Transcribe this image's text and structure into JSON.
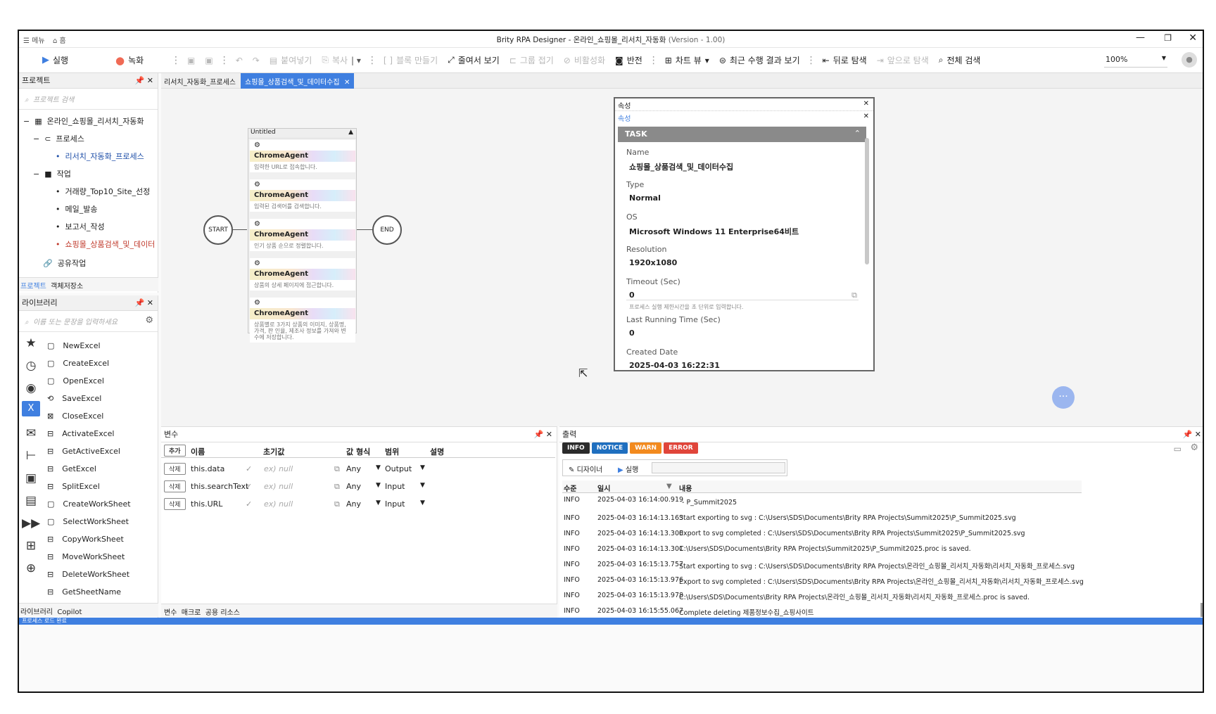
{
  "titlebar": {
    "menu": "메뉴",
    "home": "홈",
    "title": "Brity RPA Designer - 온라인_쇼핑몰_리서치_자동화",
    "version": "(Version - 1.00)"
  },
  "toolbar": {
    "run": "실행",
    "record": "녹화",
    "paste": "붙여넣기",
    "copy": "복사",
    "block": "블록 만들기",
    "zoom_out": "줄여서 보기",
    "group": "그룹 접기",
    "disable": "비활성화",
    "invert": "반전",
    "chart_view": "차트 뷰",
    "recent": "최근 수행 결과 보기",
    "back": "뒤로 탐색",
    "forward": "앞으로 탐색",
    "search_all": "전체 검색",
    "zoom": "100%"
  },
  "project": {
    "title": "프로젝트",
    "search_placeholder": "프로젝트 검색",
    "root": "온라인_쇼핑몰_리서치_자동화",
    "process_group": "프로세스",
    "process_item": "리서치_자동화_프로세스",
    "task_group": "작업",
    "tasks": [
      "거래량_Top10_Site_선정",
      "메일_발송",
      "보고서_작성",
      "쇼핑몰_상품검색_및_데이터수"
    ],
    "shared": "공유작업",
    "tabs": [
      "프로젝트",
      "객체저장소"
    ]
  },
  "library": {
    "title": "라이브러리",
    "search_placeholder": "이름 또는 문장을 입력하세요",
    "items": [
      "NewExcel",
      "CreateExcel",
      "OpenExcel",
      "SaveExcel",
      "CloseExcel",
      "ActivateExcel",
      "GetActiveExcel",
      "GetExcel",
      "SplitExcel",
      "CreateWorkSheet",
      "SelectWorkSheet",
      "CopyWorkSheet",
      "MoveWorkSheet",
      "DeleteWorkSheet",
      "GetSheetName"
    ],
    "tabs": [
      "라이브러리",
      "Copilot"
    ]
  },
  "tabs": [
    {
      "label": "리서치_자동화_프로세스"
    },
    {
      "label": "쇼핑몰_상품검색_및_데이터수집"
    }
  ],
  "flow": {
    "start": "START",
    "end": "END",
    "container": "Untitled",
    "agent": "ChromeAgent",
    "steps": [
      "입력한 URL로 접속합니다.",
      "입력된 검색어를 검색합니다.",
      "인기 상품 순으로 정렬합니다.",
      "상품의 상세 페이지에 접근합니다.",
      "상품별로 3가지 상품의 이미지, 상품명, 가격, 판 인율, 제조사 정보를 가져와 변수에 저장합니다."
    ]
  },
  "properties": {
    "title": "속성",
    "sub": "속성",
    "section": "TASK",
    "fields": [
      {
        "label": "Name",
        "value": "쇼핑몰_상품검색_및_데이터수집"
      },
      {
        "label": "Type",
        "value": "Normal"
      },
      {
        "label": "OS",
        "value": "Microsoft Windows 11 Enterprise64비트"
      },
      {
        "label": "Resolution",
        "value": "1920x1080"
      },
      {
        "label": "Timeout (Sec)",
        "value": "0"
      },
      {
        "label": "Last Running Time (Sec)",
        "value": "0"
      },
      {
        "label": "Created Date",
        "value": "2025-04-03 16:22:31"
      }
    ],
    "timeout_hint": "프로세스 실행 제한시간을 초 단위로 입력합니다."
  },
  "variables": {
    "title": "변수",
    "add": "추가",
    "headers": [
      "이름",
      "초기값",
      "값 형식",
      "범위",
      "설명"
    ],
    "rows": [
      {
        "del": "삭제",
        "name": "this.data",
        "init": "ex) null",
        "type": "Any",
        "scope": "Output"
      },
      {
        "del": "삭제",
        "name": "this.searchText",
        "init": "ex) null",
        "type": "Any",
        "scope": "Input"
      },
      {
        "del": "삭제",
        "name": "this.URL",
        "init": "ex) null",
        "type": "Any",
        "scope": "Input"
      }
    ],
    "tabs": [
      "변수",
      "매크로",
      "공용 리소스"
    ]
  },
  "output": {
    "title": "출력",
    "badges": [
      "INFO",
      "NOTICE",
      "WARN",
      "ERROR"
    ],
    "subtabs": [
      "디자이너",
      "실행"
    ],
    "headers": [
      "수준",
      "일시",
      "내용"
    ],
    "rows": [
      {
        "level": "INFO",
        "time": "2025-04-03 16:14:00.919",
        "msg": "- P_Summit2025"
      },
      {
        "level": "INFO",
        "time": "2025-04-03 16:14:13.163",
        "msg": "Start exporting to svg : C:\\Users\\SDS\\Documents\\Brity RPA Projects\\Summit2025\\P_Summit2025.svg"
      },
      {
        "level": "INFO",
        "time": "2025-04-03 16:14:13.300",
        "msg": "Export to svg completed : C:\\Users\\SDS\\Documents\\Brity RPA Projects\\Summit2025\\P_Summit2025.svg"
      },
      {
        "level": "INFO",
        "time": "2025-04-03 16:14:13.301",
        "msg": "C:\\Users\\SDS\\Documents\\Brity RPA Projects\\Summit2025\\P_Summit2025.proc is saved."
      },
      {
        "level": "INFO",
        "time": "2025-04-03 16:15:13.757",
        "msg": "Start exporting to svg : C:\\Users\\SDS\\Documents\\Brity RPA Projects\\온라인_쇼핑몰_리서치_자동화\\리서치_자동화_프로세스.svg"
      },
      {
        "level": "INFO",
        "time": "2025-04-03 16:15:13.976",
        "msg": "Export to svg completed : C:\\Users\\SDS\\Documents\\Brity RPA Projects\\온라인_쇼핑몰_리서치_자동화\\리서치_자동화_프로세스.svg"
      },
      {
        "level": "INFO",
        "time": "2025-04-03 16:15:13.978",
        "msg": "C:\\Users\\SDS\\Documents\\Brity RPA Projects\\온라인_쇼핑몰_리서치_자동화\\리서치_자동화_프로세스.proc is saved."
      },
      {
        "level": "INFO",
        "time": "2025-04-03 16:15:55.067",
        "msg": "Complete deleting 제품정보수집_쇼핑사이트"
      }
    ]
  },
  "statusbar": {
    "text": "프로세스 로드 완료"
  },
  "colors": {
    "accent": "#3f7fe0",
    "info": "#2b2b2b",
    "notice": "#1f6fbf",
    "warn": "#f28a1e",
    "error": "#e0453a",
    "section": "#8a8a8a"
  }
}
